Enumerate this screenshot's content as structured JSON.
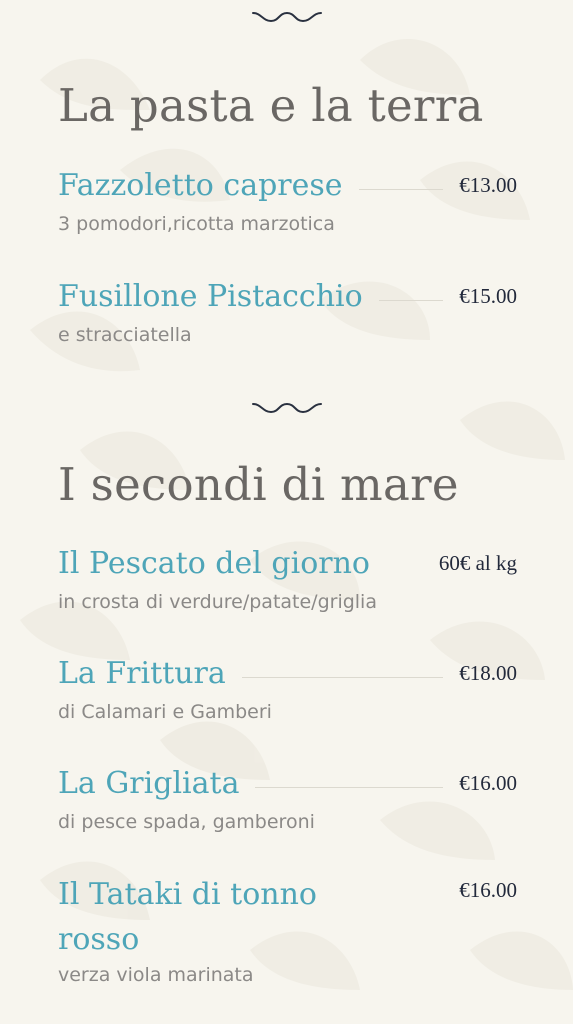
{
  "colors": {
    "background": "#f7f5ee",
    "title": "#6a6764",
    "dish": "#4ea5b8",
    "price": "#22293b",
    "description": "#8b8987"
  },
  "divider_icon": "wave-ornament-icon",
  "sections": [
    {
      "title": "La pasta e la terra",
      "items": [
        {
          "name": "Fazzoletto caprese",
          "price": "€13.00",
          "desc": "3 pomodori,ricotta marzotica"
        },
        {
          "name": "Fusillone Pistacchio",
          "price": "€15.00",
          "desc": "e stracciatella"
        }
      ]
    },
    {
      "title": "I secondi di mare",
      "items": [
        {
          "name": "Il Pescato del giorno",
          "price": "60€ al kg",
          "desc": "in crosta di verdure/patate/griglia"
        },
        {
          "name": "La Frittura",
          "price": "€18.00",
          "desc": "di Calamari e Gamberi"
        },
        {
          "name": "La Grigliata",
          "price": "€16.00",
          "desc": "di pesce spada, gamberoni"
        },
        {
          "name": "Il Tataki di tonno rosso",
          "price": "€16.00",
          "desc": "verza viola marinata"
        }
      ]
    }
  ]
}
